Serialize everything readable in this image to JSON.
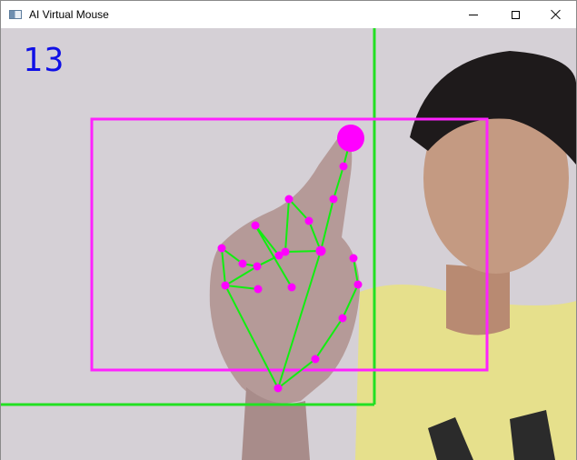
{
  "window": {
    "title": "AI Virtual Mouse",
    "controls": [
      "minimize",
      "maximize",
      "close"
    ]
  },
  "overlay": {
    "fps_counter": "13",
    "colors": {
      "frame_boundary": "#22e022",
      "active_region": "#ff22ff",
      "landmark": "#ff00ff",
      "connection": "#11ee11",
      "fps_text": "#1010e6"
    }
  },
  "hand_landmarks_count": 21
}
